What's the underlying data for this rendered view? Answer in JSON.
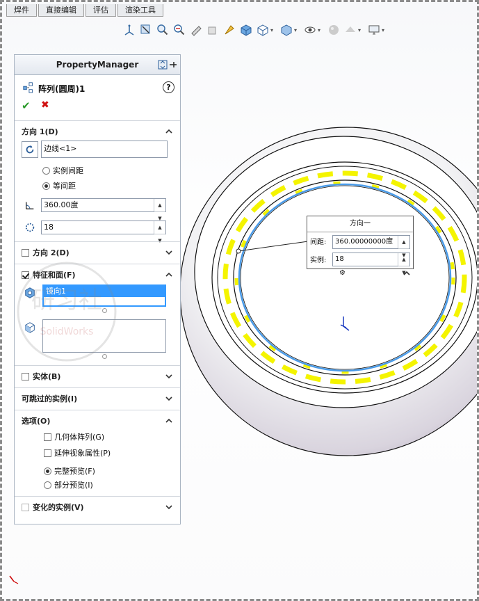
{
  "tabs": [
    "焊件",
    "直接编辑",
    "评估",
    "渲染工具"
  ],
  "toolbar_icons": [
    "view-orientation-icon",
    "zoom-to-fit-icon",
    "zoom-to-area-icon",
    "previous-view-icon",
    "section-view-icon",
    "dynamic-annotation-icon",
    "view-selector-icon",
    "standard-views-icon",
    "display-style-icon",
    "hide-show-items-icon",
    "edit-appearance-icon",
    "apply-scene-icon",
    "view-settings-icon"
  ],
  "pm": {
    "header": "PropertyManager",
    "feature_title": "阵列(圆周)1",
    "help": "?",
    "ok": "✔",
    "cancel": "✖",
    "direction1": {
      "label": "方向 1(D)",
      "edge": "边线<1>",
      "radio_instance_spacing": "实例间距",
      "radio_equal_spacing": "等间距",
      "equal_spacing_selected": true,
      "angle": "360.00度",
      "count": "18"
    },
    "direction2": {
      "label": "方向 2(D)",
      "checked": false
    },
    "features": {
      "label": "特征和面(F)",
      "checked": true,
      "items": [
        "镜向1"
      ]
    },
    "bodies": {
      "label": "实体(B)",
      "checked": false
    },
    "skip": {
      "label": "可跳过的实例(I)"
    },
    "options": {
      "label": "选项(O)",
      "geometry_pattern": "几何体阵列(G)",
      "propagate_visual": "延伸视象属性(P)",
      "full_preview": "完整预览(F)",
      "partial_preview": "部分预览(I)",
      "full_preview_selected": true
    },
    "varying": {
      "label": "变化的实例(V)",
      "checked": false
    }
  },
  "callout": {
    "title": "方向一",
    "spacing_label": "间距:",
    "spacing_value": "360.00000000度",
    "instances_label": "实例:",
    "instances_value": "18"
  },
  "watermark": {
    "text": "研习社",
    "sub": "SolidWorks"
  },
  "colors": {
    "selection_blue": "#3399ff",
    "preview_yellow": "#f4f400",
    "edge_blue": "#4a9be8"
  }
}
